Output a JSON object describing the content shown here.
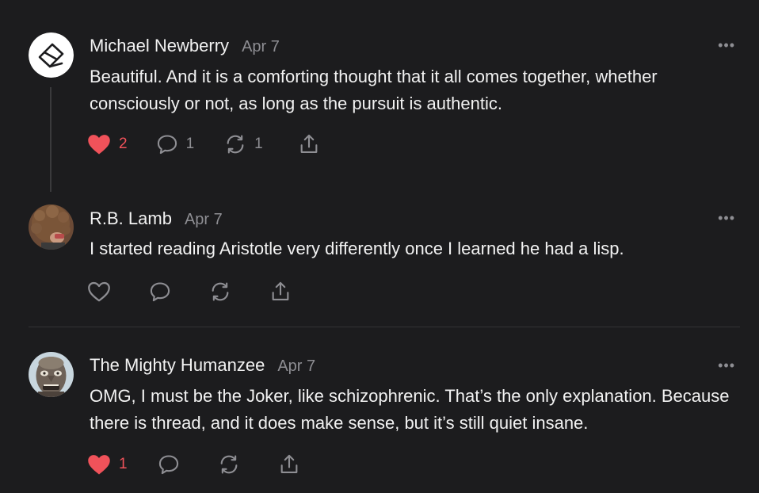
{
  "accent": {
    "heart": "#f0525a",
    "muted": "#8e8e93"
  },
  "comments": [
    {
      "author": "Michael Newberry",
      "date": "Apr 7",
      "avatar_icon": "sketch-logo-avatar",
      "text": "Beautiful. And it is a comforting thought that it all comes together, whether consciously or not, as long as the pursuit is authentic.",
      "likes": "2",
      "liked": true,
      "replies": "1",
      "restacks": "1",
      "more_label": "•••"
    },
    {
      "author": "R.B. Lamb",
      "date": "Apr 7",
      "avatar_icon": "curly-hair-photo-avatar",
      "text": "I started reading Aristotle very differently once I learned he had a lisp.",
      "liked": false,
      "more_label": "•••"
    },
    {
      "author": "The Mighty Humanzee",
      "date": "Apr 7",
      "avatar_icon": "mask-face-avatar",
      "text": "OMG, I must be the Joker, like schizophrenic. That’s the only explanation. Because there is thread, and it does make sense, but it’s still quiet insane.",
      "likes": "1",
      "liked": true,
      "more_label": "•••"
    }
  ]
}
